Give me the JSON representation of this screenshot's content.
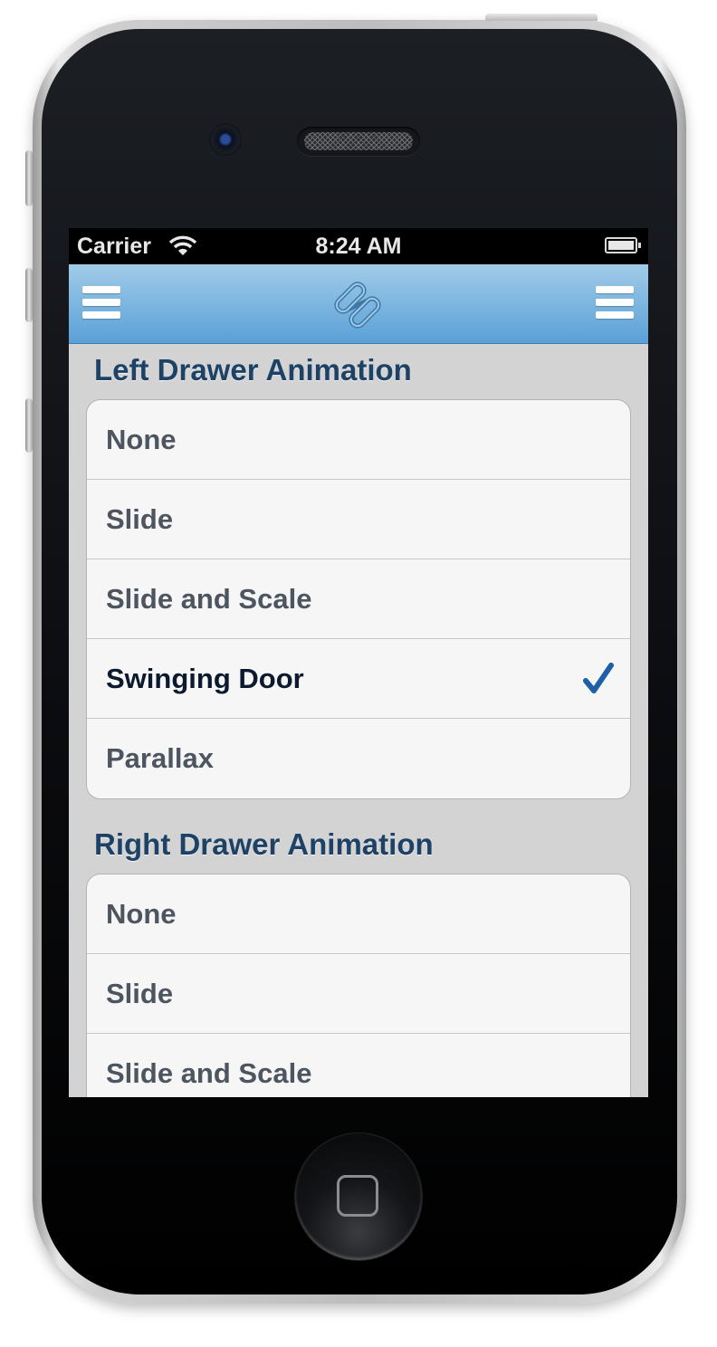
{
  "status_bar": {
    "carrier": "Carrier",
    "time": "8:24 AM"
  },
  "nav_bar": {
    "left_button_icon": "menu-icon",
    "center_icon": "app-logo-icon",
    "right_button_icon": "menu-icon"
  },
  "sections": [
    {
      "title": "Left Drawer Animation",
      "items": [
        {
          "label": "None",
          "selected": false
        },
        {
          "label": "Slide",
          "selected": false
        },
        {
          "label": "Slide and Scale",
          "selected": false
        },
        {
          "label": "Swinging Door",
          "selected": true
        },
        {
          "label": "Parallax",
          "selected": false
        }
      ]
    },
    {
      "title": "Right Drawer Animation",
      "items": [
        {
          "label": "None",
          "selected": false
        },
        {
          "label": "Slide",
          "selected": false
        },
        {
          "label": "Slide and Scale",
          "selected": false
        }
      ]
    }
  ],
  "colors": {
    "nav_top": "#a2cbe8",
    "nav_bottom": "#5ba0d6",
    "section_header": "#1d4266",
    "checkmark": "#1f5fa8",
    "background": "#d3d3d3"
  }
}
